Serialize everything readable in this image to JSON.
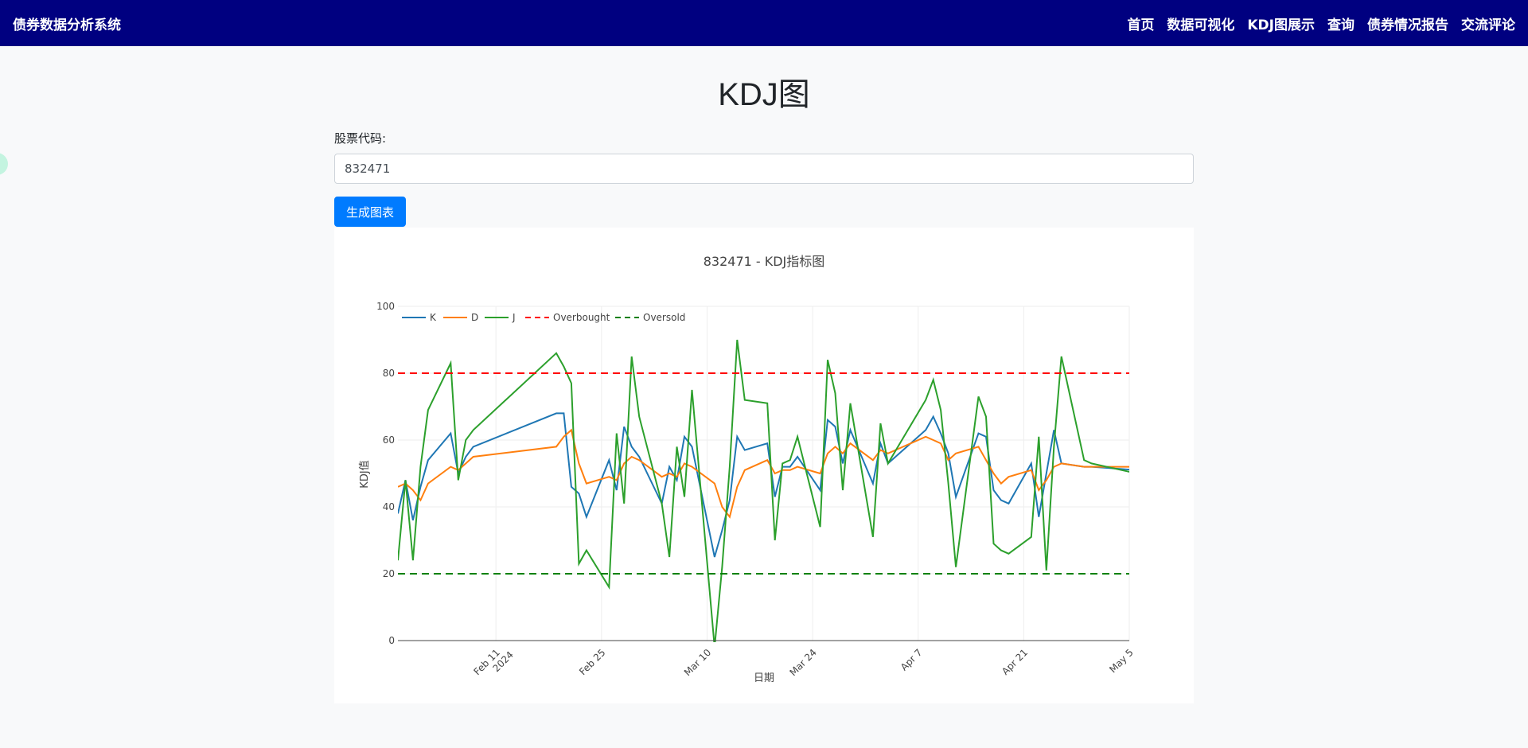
{
  "navbar": {
    "brand": "债券数据分析系统",
    "links": [
      "首页",
      "数据可视化",
      "KDJ图展示",
      "查询",
      "债券情况报告",
      "交流评论"
    ],
    "background": "#000080"
  },
  "page_title": "KDJ图",
  "form": {
    "label": "股票代码:",
    "input_value": "832471",
    "button_label": "生成图表"
  },
  "chart_data": {
    "type": "line",
    "title": "832471 - KDJ指标图",
    "xlabel": "日期",
    "ylabel": "KDJ值",
    "x_range": [
      "2024-01-29",
      "2024-05-05"
    ],
    "ylim": [
      0,
      100
    ],
    "yticks": [
      0,
      20,
      40,
      60,
      80,
      100
    ],
    "xticks": [
      {
        "date": "2024-02-11",
        "label": "Feb 11",
        "sublabel": "2024"
      },
      {
        "date": "2024-02-25",
        "label": "Feb 25",
        "sublabel": ""
      },
      {
        "date": "2024-03-10",
        "label": "Mar 10",
        "sublabel": ""
      },
      {
        "date": "2024-03-24",
        "label": "Mar 24",
        "sublabel": ""
      },
      {
        "date": "2024-04-07",
        "label": "Apr 7",
        "sublabel": ""
      },
      {
        "date": "2024-04-21",
        "label": "Apr 21",
        "sublabel": ""
      },
      {
        "date": "2024-05-05",
        "label": "May 5",
        "sublabel": ""
      }
    ],
    "grid": true,
    "legend_position": "top-left",
    "x": [
      "2024-01-29",
      "2024-01-30",
      "2024-01-31",
      "2024-02-01",
      "2024-02-02",
      "2024-02-05",
      "2024-02-06",
      "2024-02-07",
      "2024-02-08",
      "2024-02-19",
      "2024-02-20",
      "2024-02-21",
      "2024-02-22",
      "2024-02-23",
      "2024-02-26",
      "2024-02-27",
      "2024-02-28",
      "2024-02-29",
      "2024-03-01",
      "2024-03-04",
      "2024-03-05",
      "2024-03-06",
      "2024-03-07",
      "2024-03-08",
      "2024-03-11",
      "2024-03-12",
      "2024-03-13",
      "2024-03-14",
      "2024-03-15",
      "2024-03-18",
      "2024-03-19",
      "2024-03-20",
      "2024-03-21",
      "2024-03-22",
      "2024-03-25",
      "2024-03-26",
      "2024-03-27",
      "2024-03-28",
      "2024-03-29",
      "2024-04-01",
      "2024-04-02",
      "2024-04-03",
      "2024-04-08",
      "2024-04-09",
      "2024-04-10",
      "2024-04-11",
      "2024-04-12",
      "2024-04-15",
      "2024-04-16",
      "2024-04-17",
      "2024-04-18",
      "2024-04-19",
      "2024-04-22",
      "2024-04-23",
      "2024-04-24",
      "2024-04-25",
      "2024-04-26",
      "2024-04-29",
      "2024-04-30",
      "2024-05-06"
    ],
    "series": [
      {
        "name": "K",
        "color": "#1f77b4",
        "dash": "solid",
        "values": [
          38,
          48,
          36,
          46,
          54,
          62,
          50,
          55,
          58,
          68,
          68,
          46,
          44,
          37,
          54,
          45,
          64,
          58,
          55,
          41,
          52,
          48,
          61,
          58,
          25,
          33,
          42,
          61,
          57,
          59,
          43,
          52,
          52,
          55,
          45,
          66,
          64,
          53,
          63,
          47,
          59,
          53,
          63,
          67,
          62,
          56,
          43,
          62,
          61,
          45,
          42,
          41,
          53,
          37,
          50,
          63,
          53,
          52,
          52,
          51
        ]
      },
      {
        "name": "D",
        "color": "#ff7f0e",
        "dash": "solid",
        "values": [
          46,
          47,
          45,
          42,
          47,
          52,
          51,
          53,
          55,
          58,
          61,
          63,
          53,
          47,
          49,
          48,
          53,
          55,
          54,
          49,
          50,
          49,
          53,
          52,
          47,
          40,
          37,
          46,
          51,
          54,
          50,
          51,
          51,
          52,
          50,
          56,
          58,
          56,
          59,
          54,
          57,
          56,
          61,
          60,
          59,
          54,
          56,
          58,
          54,
          50,
          47,
          49,
          51,
          45,
          48,
          52,
          53,
          52,
          52,
          52
        ]
      },
      {
        "name": "J",
        "color": "#2ca02c",
        "dash": "solid",
        "values": [
          24,
          48,
          24,
          52,
          69,
          83,
          48,
          60,
          63,
          86,
          82,
          77,
          23,
          27,
          16,
          62,
          41,
          85,
          67,
          41,
          25,
          58,
          43,
          75,
          -2,
          22,
          52,
          90,
          72,
          71,
          30,
          53,
          54,
          61,
          34,
          84,
          74,
          45,
          71,
          31,
          65,
          53,
          72,
          78,
          69,
          47,
          22,
          73,
          67,
          29,
          27,
          26,
          31,
          61,
          21,
          58,
          85,
          54,
          53,
          50
        ]
      },
      {
        "name": "Overbought",
        "color": "#ff0000",
        "dash": "dashed",
        "values": [
          80,
          80
        ]
      },
      {
        "name": "Oversold",
        "color": "#008000",
        "dash": "dashed",
        "values": [
          20,
          20
        ]
      }
    ]
  }
}
